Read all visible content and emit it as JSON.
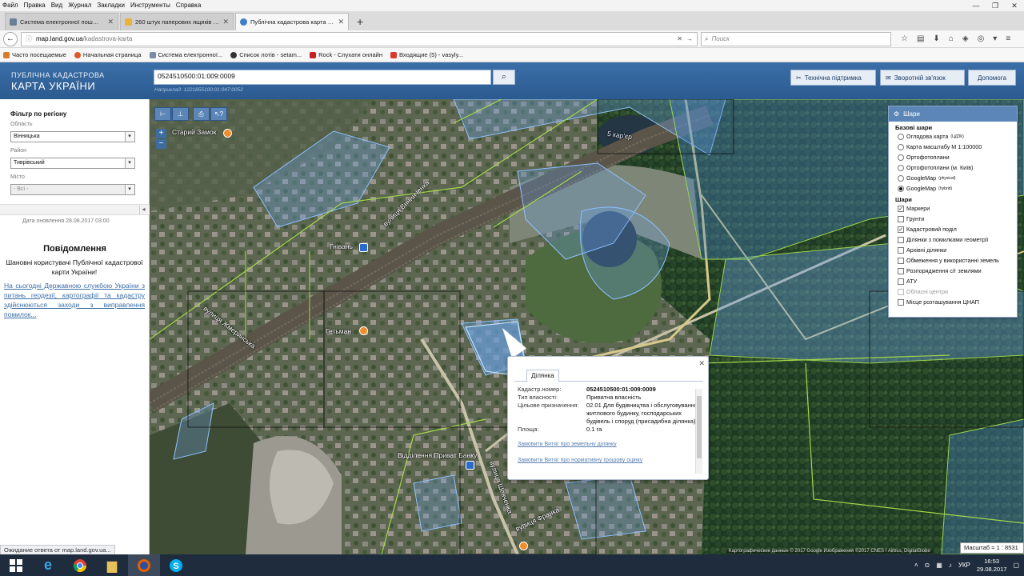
{
  "browser": {
    "menu": [
      "Файл",
      "Правка",
      "Вид",
      "Журнал",
      "Закладки",
      "Инструменты",
      "Справка"
    ],
    "tabs": [
      {
        "label": "Система електронної пош…",
        "active": false
      },
      {
        "label": "260 штук паперових ящиків в …",
        "active": false
      },
      {
        "label": "Публічна кадастрова карта …",
        "active": true
      }
    ],
    "url_domain": "map.land.gov.ua",
    "url_path": "/kadastrova-karta",
    "search_placeholder": "Поиск",
    "bookmarks": [
      "Часто посещаемые",
      "Начальная страница",
      "Система електронної...",
      "Список лотів - setam...",
      "Rock - Слухати онлайн",
      "Входящие (5) - vasyly..."
    ],
    "status_text": "Ожидание ответа от map.land.gov.ua..."
  },
  "header": {
    "logo_line1": "ПУБЛІЧНА КАДАСТРОВА",
    "logo_line2": "КАРТА УКРАЇНИ",
    "search_value": "0524510500:01:009:0009",
    "search_hint": "Наприклад: 1221855100:01:047:0052",
    "buttons": [
      "Технічна підтримка",
      "Зворотній зв'язок",
      "Допомога"
    ]
  },
  "sidebar": {
    "filter_title": "Фільтр по регіону",
    "region_label": "Область",
    "region_value": "Вінницька",
    "district_label": "Район",
    "district_value": "Тиврівський",
    "city_label": "Місто",
    "city_value": "- Всі -",
    "updated": "Дата оновлення  28.08.2017 03:00",
    "news_title": "Повідомлення",
    "news_text": "Шановні користувачі Публічної кадастрової карти України!",
    "news_link": "На сьогодні Державною службою України з питань геодезії, картографії та кадастру здійснюються заходи з виправлення помилок..."
  },
  "map": {
    "labels": [
      {
        "id": "staryi-zamok",
        "text": "Старий Замок"
      },
      {
        "id": "karier",
        "text": "5 кар'єр"
      },
      {
        "id": "hnivan",
        "text": "Гнівань"
      },
      {
        "id": "hetman",
        "text": "Гетьман"
      },
      {
        "id": "bank",
        "text": "Відділення Приват Банку"
      },
      {
        "id": "zhmerynska",
        "text": "вулиця Жмеринська"
      },
      {
        "id": "shevchenka",
        "text": "вулиця Шевченка"
      },
      {
        "id": "franka",
        "text": "вулиця Франка"
      },
      {
        "id": "vinnychenka",
        "text": "вулиця Винниченка"
      }
    ],
    "attribution": "Картографические данные © 2017 Google Изображения ©2017 CNES / Airbus, DigitalGlobe",
    "scale": "Масштаб = 1 : 8531"
  },
  "layers": {
    "title": "Шари",
    "base_title": "Базові шари",
    "base": [
      {
        "label": "Оглядова карта",
        "sup": "(ЦДЗК)",
        "on": false
      },
      {
        "label": "Карта масштабу М 1:100000",
        "sup": "",
        "on": false
      },
      {
        "label": "Ортофотоплани",
        "sup": "",
        "on": false
      },
      {
        "label": "Ортофотоплани (м. Київ)",
        "sup": "",
        "on": false
      },
      {
        "label": "GoogleMap",
        "sup": "(physical)",
        "on": false
      },
      {
        "label": "GoogleMap",
        "sup": "(hybrid)",
        "on": true
      }
    ],
    "overlay_title": "Шари",
    "overlays": [
      {
        "label": "Маркери",
        "on": true,
        "dim": false
      },
      {
        "label": "Грунти",
        "on": false,
        "dim": false
      },
      {
        "label": "Кадастровий поділ",
        "on": true,
        "dim": false
      },
      {
        "label": "Ділянки з помилками геометрії",
        "on": false,
        "dim": false
      },
      {
        "label": "Архівні ділянки",
        "on": false,
        "dim": false
      },
      {
        "label": "Обмеження у використанні земель",
        "on": false,
        "dim": false
      },
      {
        "label": "Розпорядження с/г землями",
        "on": false,
        "dim": false
      },
      {
        "label": "АТУ",
        "on": false,
        "dim": false
      },
      {
        "label": "Обласні центри",
        "on": false,
        "dim": true
      },
      {
        "label": "Місце розташування ЦНАП",
        "on": false,
        "dim": false
      }
    ]
  },
  "popup": {
    "tab": "Ділянка",
    "rows": [
      {
        "k": "Кадастр.номер:",
        "v": "0524510500:01:009:0009"
      },
      {
        "k": "Тип власності:",
        "v": "Приватна власність"
      },
      {
        "k": "Цільове призначення:",
        "v": "02.01 Для будівництва і обслуговування житлового будинку, господарських будівель і споруд (присадибна ділянка)"
      },
      {
        "k": "Площа:",
        "v": "0.1 га"
      }
    ],
    "link1": "Замовити Витяг про земельну ділянку",
    "link2": "Замовити Витяг про нормативну грошову оцінку"
  },
  "taskbar": {
    "lang": "УКР",
    "time": "16:53",
    "date": "29.08.2017"
  }
}
